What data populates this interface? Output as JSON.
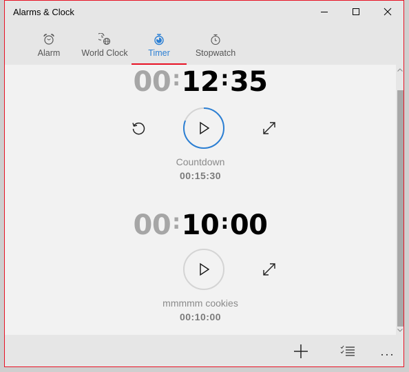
{
  "window": {
    "title": "Alarms & Clock",
    "controls": {
      "minimize": "minimize-icon",
      "maximize": "maximize-icon",
      "close": "close-icon"
    }
  },
  "tabs": [
    {
      "label": "Alarm",
      "icon": "alarm-clock-icon",
      "active": false
    },
    {
      "label": "World Clock",
      "icon": "world-clock-icon",
      "active": false
    },
    {
      "label": "Timer",
      "icon": "timer-icon",
      "active": true
    },
    {
      "label": "Stopwatch",
      "icon": "stopwatch-icon",
      "active": false
    }
  ],
  "accent_color": "#2b7fd4",
  "active_tab_underline_color": "#e81123",
  "timers": [
    {
      "remaining": {
        "hours": "00",
        "minutes": "12",
        "seconds": "35"
      },
      "name": "Countdown",
      "duration": "00:15:30",
      "progress_remaining": 0.81,
      "has_reset": true,
      "state": "paused"
    },
    {
      "remaining": {
        "hours": "00",
        "minutes": "10",
        "seconds": "00"
      },
      "name": "mmmmm cookies",
      "duration": "00:10:00",
      "progress_remaining": 1.0,
      "has_reset": false,
      "state": "not-started"
    }
  ],
  "footer": {
    "add_label": "New timer",
    "select_label": "Select timers",
    "more_label": "..."
  }
}
